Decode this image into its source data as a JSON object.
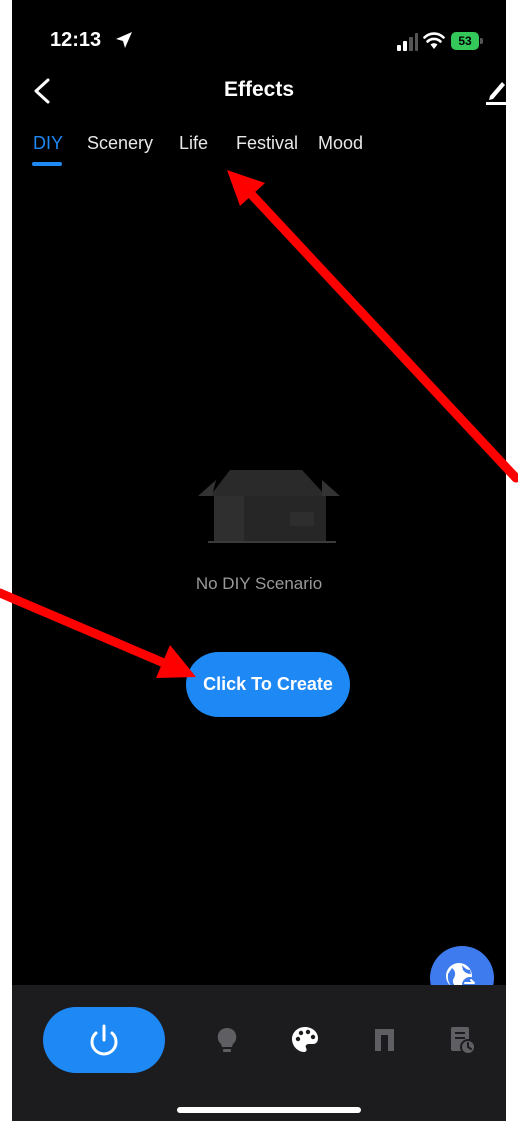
{
  "status_bar": {
    "time": "12:13",
    "battery": "53"
  },
  "header": {
    "title": "Effects"
  },
  "tabs": [
    {
      "label": "DIY",
      "active": true
    },
    {
      "label": "Scenery",
      "active": false
    },
    {
      "label": "Life",
      "active": false
    },
    {
      "label": "Festival",
      "active": false
    },
    {
      "label": "Mood",
      "active": false
    }
  ],
  "empty_state": {
    "message": "No DIY Scenario",
    "button_label": "Click To Create"
  },
  "bottom_nav": {
    "items": [
      "power-icon",
      "bulb-icon",
      "palette-icon",
      "music-icon",
      "schedule-icon"
    ],
    "active": "palette-icon"
  },
  "colors": {
    "accent": "#1e88f5",
    "background": "#000000",
    "nav_background": "#1c1c1e",
    "annotation": "#ff0000"
  }
}
